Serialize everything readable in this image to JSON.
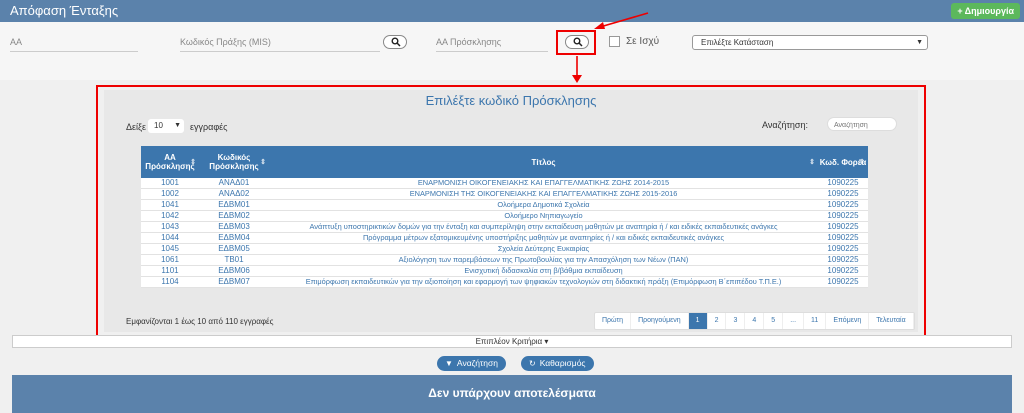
{
  "header": {
    "title": "Απόφαση Ένταξης",
    "create_label": "Δημιουργία"
  },
  "filters": {
    "aa_placeholder": "ΑΑ",
    "mis_placeholder": "Κωδικός Πράξης (MIS)",
    "call_aa_placeholder": "ΑΑ Πρόσκλησης",
    "in_force_label": "Σε Ισχύ",
    "status_select": "Επιλέξτε Κατάσταση"
  },
  "modal": {
    "title": "Επιλέξτε κωδικό Πρόσκλησης",
    "show_label": "Δείξε",
    "page_size": "10",
    "entries_label": "εγγραφές",
    "search_label": "Αναζήτηση:",
    "search_placeholder": "Αναζήτηση",
    "columns": [
      "ΑΑ Πρόσκλησης",
      "Κωδικός Πρόσκλησης",
      "Τίτλος",
      "Κωδ. Φορέα"
    ],
    "rows": [
      [
        "1001",
        "ΑΝΑΔ01",
        "ΕΝΑΡΜΟΝΙΣΗ ΟΙΚΟΓΕΝΕΙΑΚΗΣ ΚΑΙ ΕΠΑΓΓΕΛΜΑΤΙΚΗΣ ΖΩΗΣ 2014-2015",
        "1090225"
      ],
      [
        "1002",
        "ΑΝΑΔ02",
        "ΕΝΑΡΜΟΝΙΣΗ ΤΗΣ ΟΙΚΟΓΕΝΕΙΑΚΗΣ ΚΑΙ ΕΠΑΓΓΕΛΜΑΤΙΚΗΣ ΖΩΗΣ 2015-2016",
        "1090225"
      ],
      [
        "1041",
        "ΕΔΒΜ01",
        "Ολοήμερα Δημοτικά Σχολεία",
        "1090225"
      ],
      [
        "1042",
        "ΕΔΒΜ02",
        "Ολοήμερο Νηπιαγωγείο",
        "1090225"
      ],
      [
        "1043",
        "ΕΔΒΜ03",
        "Ανάπτυξη υποστηρικτικών δομών για την ένταξη και συμπερίληψη στην εκπαίδευση μαθητών με αναπηρία ή / και ειδικές εκπαιδευτικές ανάγκες",
        "1090225"
      ],
      [
        "1044",
        "ΕΔΒΜ04",
        "Πρόγραμμα μέτρων εξατομικευμένης υποστήριξης μαθητών με αναπηρίες ή / και ειδικές εκπαιδευτικές ανάγκες",
        "1090225"
      ],
      [
        "1045",
        "ΕΔΒΜ05",
        "Σχολεία Δεύτερης Ευκαιρίας",
        "1090225"
      ],
      [
        "1061",
        "ΤΒ01",
        "Αξιολόγηση των παρεμβάσεων της Πρωτοβουλίας για την Απασχόληση των Νέων (ΠΑΝ)",
        "1090225"
      ],
      [
        "1101",
        "ΕΔΒΜ06",
        "Ενισχυτική διδασκαλία στη β/βάθμια εκπαίδευση",
        "1090225"
      ],
      [
        "1104",
        "ΕΔΒΜ07",
        "Επιμόρφωση εκπαιδευτικών για την αξιοποίηση και εφαρμογή των ψηφιακών τεχνολογιών στη διδακτική πράξη (Επιμόρφωση Β΄επιπέδου Τ.Π.Ε.)",
        "1090225"
      ]
    ],
    "info": "Εμφανίζονται 1 έως 10 από 110 εγγραφές",
    "pager": [
      "Πρώτη",
      "Προηγούμενη",
      "1",
      "2",
      "3",
      "4",
      "5",
      "...",
      "11",
      "Επόμενη",
      "Τελευταία"
    ],
    "active_page": "1"
  },
  "more_criteria": "Επιπλέον Κριτήρια",
  "buttons": {
    "search": "Αναζήτηση",
    "clear": "Καθαρισμός"
  },
  "no_results": "Δεν υπάρχουν αποτελέσματα",
  "colors": {
    "primary": "#3c76ad",
    "header": "#5b82ab",
    "success": "#5cb85c",
    "highlight": "#ee0000"
  }
}
